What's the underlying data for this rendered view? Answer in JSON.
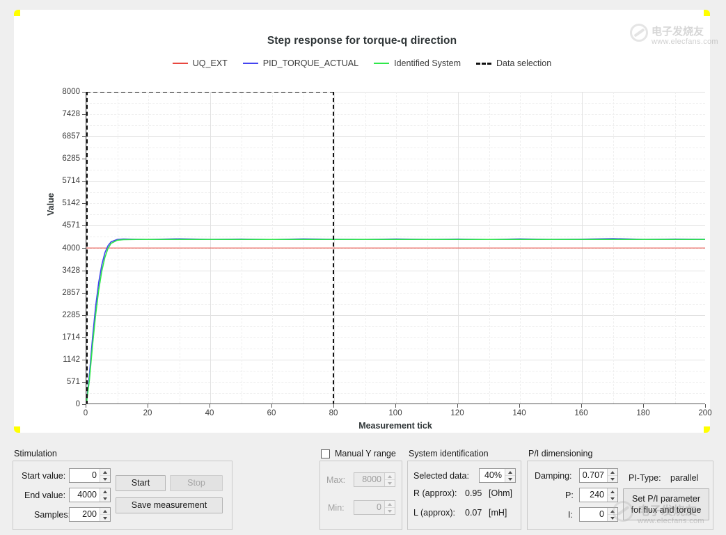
{
  "window": {
    "background_color": "#efefef",
    "card_background": "#ffffff",
    "corner_accent_color": "#ffff00"
  },
  "chart_data": {
    "type": "line",
    "title": "Step response for torque-q direction",
    "xlabel": "Measurement tick",
    "ylabel": "Value",
    "xlim": [
      0,
      200
    ],
    "ylim": [
      0,
      8000
    ],
    "grid": true,
    "legend_position": "top-center",
    "y_ticks": [
      0,
      571,
      1142,
      1714,
      2285,
      2857,
      3428,
      4000,
      4571,
      5142,
      5714,
      6285,
      6857,
      7428,
      8000
    ],
    "x_ticks": [
      0,
      20,
      40,
      60,
      80,
      100,
      120,
      140,
      160,
      180,
      200
    ],
    "annotations": [
      {
        "name": "data-selection-box",
        "x_start": 0,
        "x_end": 80,
        "y_start": 0,
        "y_end": 8000,
        "style": "dashed",
        "color": "#111111"
      }
    ],
    "series": [
      {
        "name": "UQ_EXT",
        "color": "#e8473f",
        "style": "solid",
        "x": [
          0,
          200
        ],
        "values": [
          4000,
          4000
        ]
      },
      {
        "name": "PID_TORQUE_ACTUAL",
        "color": "#4444f0",
        "style": "solid",
        "x": [
          0,
          1,
          2,
          3,
          4,
          5,
          6,
          7,
          8,
          10,
          12,
          16,
          20,
          30,
          40,
          50,
          60,
          70,
          80,
          90,
          100,
          110,
          120,
          130,
          140,
          150,
          160,
          170,
          180,
          190,
          200
        ],
        "values": [
          0,
          760,
          1700,
          2500,
          3120,
          3570,
          3880,
          4060,
          4160,
          4220,
          4230,
          4225,
          4220,
          4235,
          4222,
          4228,
          4218,
          4232,
          4224,
          4220,
          4230,
          4222,
          4228,
          4218,
          4233,
          4222,
          4226,
          4240,
          4222,
          4228,
          4225
        ]
      },
      {
        "name": "Identified System",
        "color": "#2ee84a",
        "style": "solid",
        "x": [
          0,
          1,
          2,
          3,
          4,
          5,
          6,
          7,
          8,
          10,
          12,
          16,
          20,
          40,
          60,
          80,
          100,
          120,
          140,
          160,
          180,
          200
        ],
        "values": [
          0,
          620,
          1500,
          2280,
          2920,
          3410,
          3760,
          3990,
          4120,
          4200,
          4215,
          4220,
          4220,
          4220,
          4220,
          4220,
          4220,
          4220,
          4220,
          4220,
          4220,
          4220
        ]
      },
      {
        "name": "Data selection",
        "color": "#111111",
        "style": "dashed",
        "x": [],
        "values": []
      }
    ]
  },
  "stimulation": {
    "group_label": "Stimulation",
    "start_value_label": "Start value:",
    "start_value": "0",
    "end_value_label": "End value:",
    "end_value": "4000",
    "samples_label": "Samples:",
    "samples": "200",
    "start_button": "Start",
    "stop_button": "Stop",
    "save_button": "Save measurement"
  },
  "manual_y_range": {
    "checkbox_label": "Manual Y  range",
    "checked": false,
    "max_label": "Max:",
    "max_value": "8000",
    "min_label": "Min:",
    "min_value": "0",
    "enabled": false
  },
  "system_identification": {
    "group_label": "System identification",
    "selected_data_label": "Selected data:",
    "selected_data_value": "40%",
    "r_label": "R (approx):",
    "r_value": "0.95",
    "r_unit": "[Ohm]",
    "l_label": "L (approx):",
    "l_value": "0.07",
    "l_unit": "[mH]"
  },
  "pi_dimensioning": {
    "group_label": "P/I dimensioning",
    "damping_label": "Damping:",
    "damping_value": "0.707",
    "p_label": "P:",
    "p_value": "240",
    "i_label": "I:",
    "i_value": "0",
    "pi_type_label": "PI-Type:",
    "pi_type_value": "parallel",
    "set_button_line1": "Set P/I parameter",
    "set_button_line2": "for flux and torque"
  },
  "watermark": {
    "text_cn": "电子发烧友",
    "url": "www.elecfans.com"
  }
}
